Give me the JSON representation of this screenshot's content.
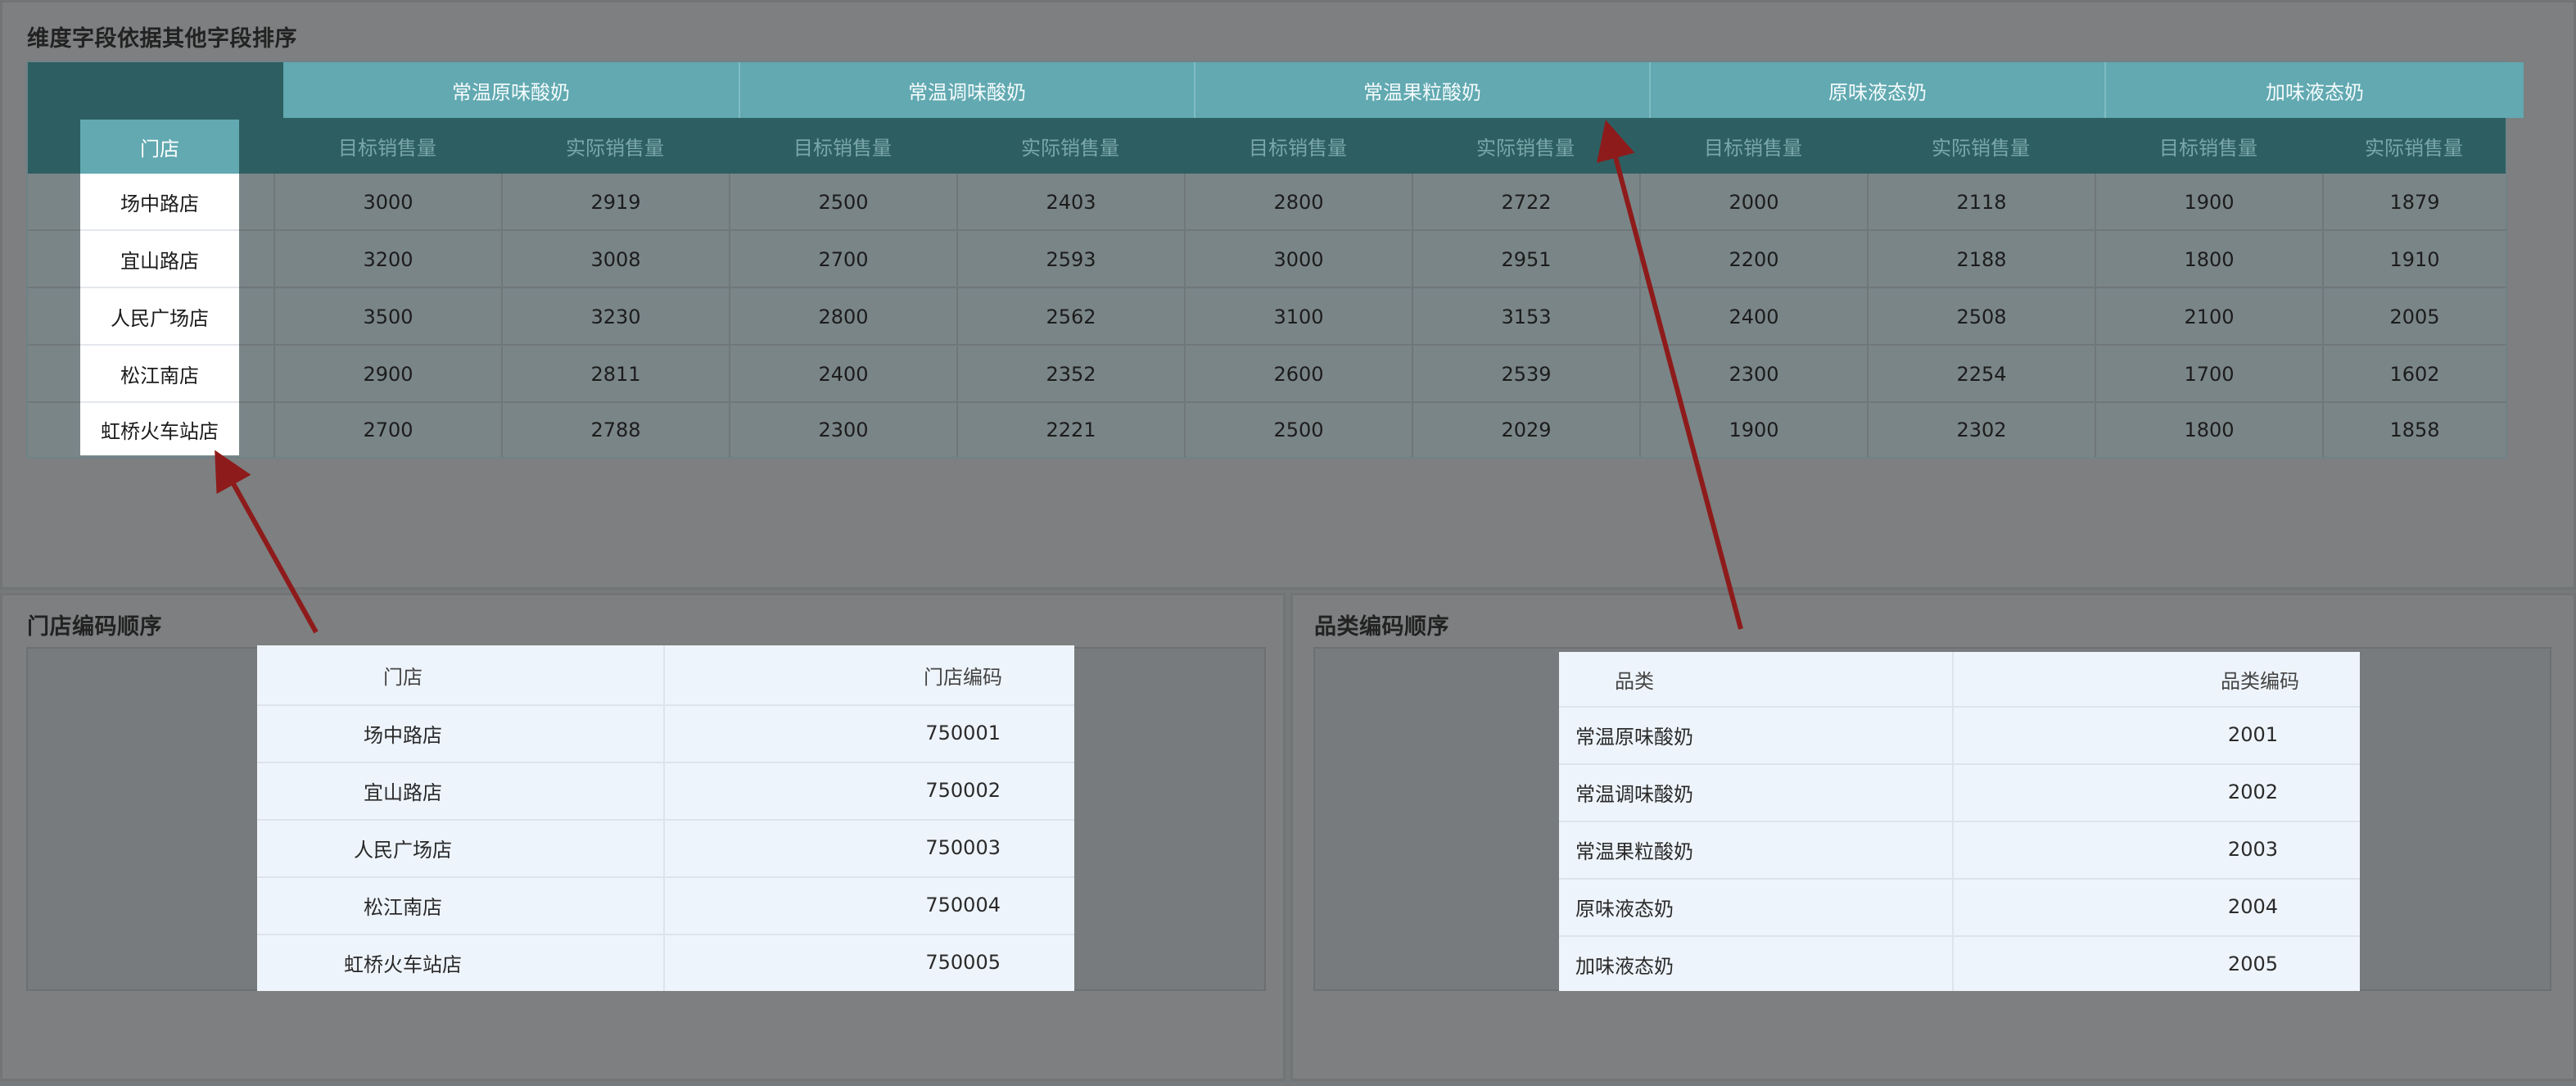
{
  "top_panel": {
    "title": "维度字段依据其他字段排序",
    "store_header": "门店",
    "categories": [
      "常温原味酸奶",
      "常温调味酸奶",
      "常温果粒酸奶",
      "原味液态奶",
      "加味液态奶"
    ],
    "sub_headers": [
      "目标销售量",
      "实际销售量"
    ],
    "rows": [
      {
        "store": "场中路店",
        "values": [
          "3000",
          "2919",
          "2500",
          "2403",
          "2800",
          "2722",
          "2000",
          "2118",
          "1900",
          "1879"
        ]
      },
      {
        "store": "宜山路店",
        "values": [
          "3200",
          "3008",
          "2700",
          "2593",
          "3000",
          "2951",
          "2200",
          "2188",
          "1800",
          "1910"
        ]
      },
      {
        "store": "人民广场店",
        "values": [
          "3500",
          "3230",
          "2800",
          "2562",
          "3100",
          "3153",
          "2400",
          "2508",
          "2100",
          "2005"
        ]
      },
      {
        "store": "松江南店",
        "values": [
          "2900",
          "2811",
          "2400",
          "2352",
          "2600",
          "2539",
          "2300",
          "2254",
          "1700",
          "1602"
        ]
      },
      {
        "store": "虹桥火车站店",
        "values": [
          "2700",
          "2788",
          "2300",
          "2221",
          "2500",
          "2029",
          "1900",
          "2302",
          "1800",
          "1858"
        ]
      }
    ]
  },
  "store_panel": {
    "title": "门店编码顺序",
    "headers": [
      "门店",
      "门店编码"
    ],
    "rows": [
      [
        "场中路店",
        "750001"
      ],
      [
        "宜山路店",
        "750002"
      ],
      [
        "人民广场店",
        "750003"
      ],
      [
        "松江南店",
        "750004"
      ],
      [
        "虹桥火车站店",
        "750005"
      ]
    ]
  },
  "category_panel": {
    "title": "品类编码顺序",
    "headers": [
      "品类",
      "品类编码"
    ],
    "rows": [
      [
        "常温原味酸奶",
        "2001"
      ],
      [
        "常温调味酸奶",
        "2002"
      ],
      [
        "常温果粒酸奶",
        "2003"
      ],
      [
        "原味液态奶",
        "2004"
      ],
      [
        "加味液态奶",
        "2005"
      ]
    ]
  },
  "colors": {
    "arrow": "#8e1b1b",
    "header_dark": "#2d5f62",
    "header_teal": "#62a9b1",
    "table_light": "#eef4fb"
  }
}
